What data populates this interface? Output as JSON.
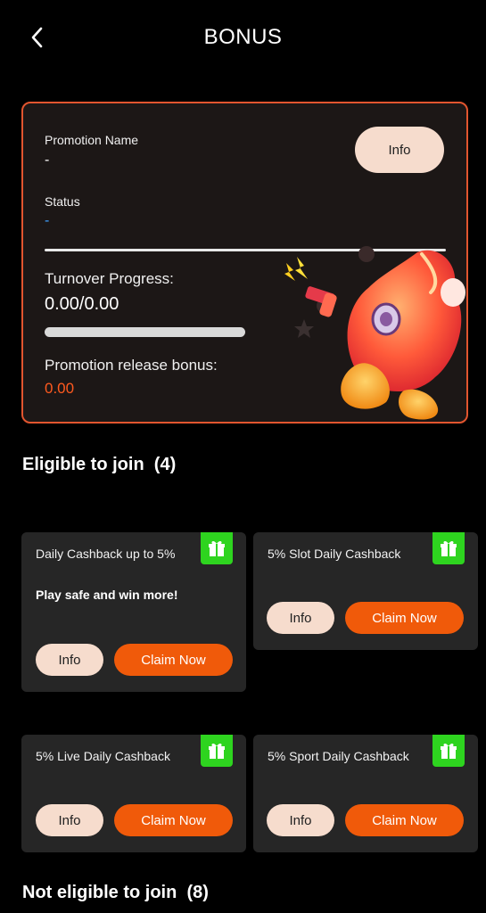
{
  "header": {
    "title": "BONUS"
  },
  "summary": {
    "promotion_name_label": "Promotion Name",
    "promotion_name_value": "-",
    "status_label": "Status",
    "status_value": "-",
    "info_label": "Info",
    "turnover_label": "Turnover Progress:",
    "turnover_value": "0.00/0.00",
    "turnover_progress": 0,
    "release_label": "Promotion release bonus:",
    "release_value": "0.00"
  },
  "eligible": {
    "title": "Eligible to join",
    "count": "(4)",
    "cards": [
      {
        "name": "Daily Cashback up to 5%",
        "description": "Play safe and win more!",
        "info_label": "Info",
        "claim_label": "Claim Now"
      },
      {
        "name": "5% Slot Daily Cashback",
        "description": "",
        "info_label": "Info",
        "claim_label": "Claim Now"
      },
      {
        "name": "5% Live Daily Cashback",
        "description": "",
        "info_label": "Info",
        "claim_label": "Claim Now"
      },
      {
        "name": "5% Sport Daily Cashback",
        "description": "",
        "info_label": "Info",
        "claim_label": "Claim Now"
      }
    ]
  },
  "not_eligible": {
    "title": "Not eligible to join",
    "count": "(8)"
  },
  "colors": {
    "accent": "#f05a0a",
    "gift": "#2ed41f",
    "info_button": "#f6dccd",
    "border": "#e2552f"
  }
}
